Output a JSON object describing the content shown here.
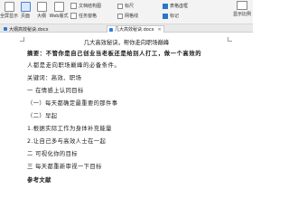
{
  "ribbon": {
    "buttons": [
      {
        "label": "全屏显示",
        "icon": "fullscreen-icon"
      },
      {
        "label": "页面",
        "icon": "page-view-icon"
      },
      {
        "label": "大纲",
        "icon": "outline-icon"
      },
      {
        "label": "Web版式",
        "icon": "web-layout-icon"
      }
    ],
    "check_left": [
      "文档结构图",
      "任务窗格"
    ],
    "check_mid": [
      "标尺",
      "网格线"
    ],
    "check_right": [
      "表格虚框",
      "标记"
    ],
    "zoom_label": "显示比例"
  },
  "tabs": [
    {
      "label": "大纲高效秘诀.docx",
      "active": false
    },
    {
      "label": "几大高效秘诀.docx",
      "active": true
    }
  ],
  "document": {
    "title": "几大高效秘诀，帮你走向职场巅峰",
    "abstract_line1": "摘要：不管你是自己创业当老板还是给别人打工，做一个高效的",
    "abstract_line2": "人都是走向职场巅峰的必备条件。",
    "keywords": "关键词：高效、职场",
    "sections": [
      "一 在情感上认同目标",
      "（一）每天都确定最重要的那件事",
      "（二）早起",
      "1.根据实际工作为身体补充能量",
      "2.让自己多与高效人士在一起",
      "二 可视化你的目标",
      "三 每天都重新审视一下目标",
      "参考文献"
    ]
  }
}
